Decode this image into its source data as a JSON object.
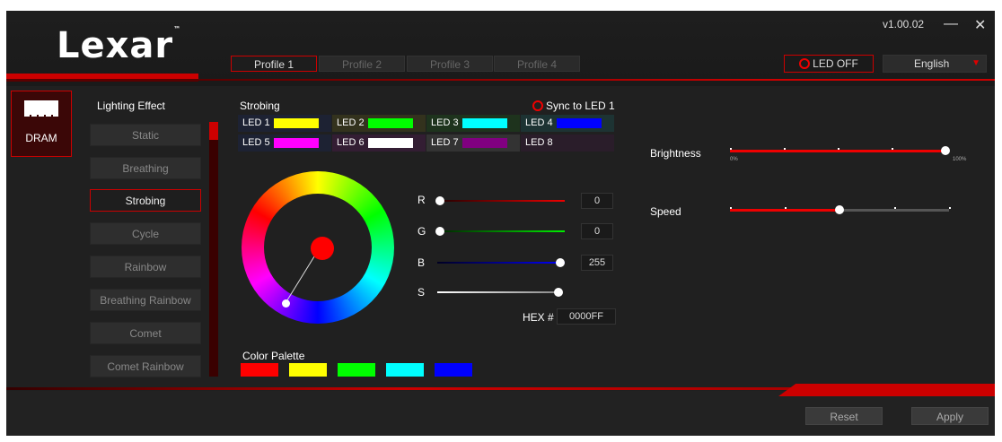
{
  "app": {
    "logo": "Lexar",
    "version": "v1.00.02"
  },
  "window_controls": {
    "minimize_glyph": "—",
    "close_glyph": "✕"
  },
  "profiles": [
    "Profile 1",
    "Profile 2",
    "Profile 3",
    "Profile 4"
  ],
  "active_profile": "Profile 1",
  "led_off_label": "LED OFF",
  "language": {
    "selected": "English"
  },
  "device": {
    "label": "DRAM",
    "icon": "memory-module-icon"
  },
  "lighting": {
    "title": "Lighting Effect",
    "effects": [
      "Static",
      "Breathing",
      "Strobing",
      "Cycle",
      "Rainbow",
      "Breathing Rainbow",
      "Comet",
      "Comet Rainbow"
    ],
    "active": "Strobing"
  },
  "panel": {
    "title": "Strobing",
    "sync_label": "Sync to LED 1",
    "leds": [
      {
        "label": "LED 1",
        "color": "#0000ff"
      },
      {
        "label": "LED 2",
        "color": "#ffff00"
      },
      {
        "label": "LED 3",
        "color": "#00ff00"
      },
      {
        "label": "LED 4",
        "color": "#00ffff"
      },
      {
        "label": "LED 5",
        "color": "#0000ff"
      },
      {
        "label": "LED 6",
        "color": "#ff00ff"
      },
      {
        "label": "LED 7",
        "color": "#ffffff"
      },
      {
        "label": "LED 8",
        "color": "#800080"
      }
    ]
  },
  "rgb": {
    "r_label": "R",
    "r_value": "0",
    "g_label": "G",
    "g_value": "0",
    "b_label": "B",
    "b_value": "255",
    "s_label": "S",
    "hex_label": "HEX #",
    "hex_value": "0000FF"
  },
  "palette": {
    "title": "Color Palette",
    "colors": [
      "#ff0000",
      "#ffff00",
      "#00ff00",
      "#00ffff",
      "#0000ff"
    ]
  },
  "brightness": {
    "label": "Brightness",
    "min_label": "0%",
    "max_label": "100%",
    "value_percent": 100
  },
  "speed": {
    "label": "Speed",
    "value_percent": 50
  },
  "footer": {
    "reset_label": "Reset",
    "apply_label": "Apply"
  },
  "colors": {
    "accent": "#cc0000",
    "background": "#202020"
  }
}
